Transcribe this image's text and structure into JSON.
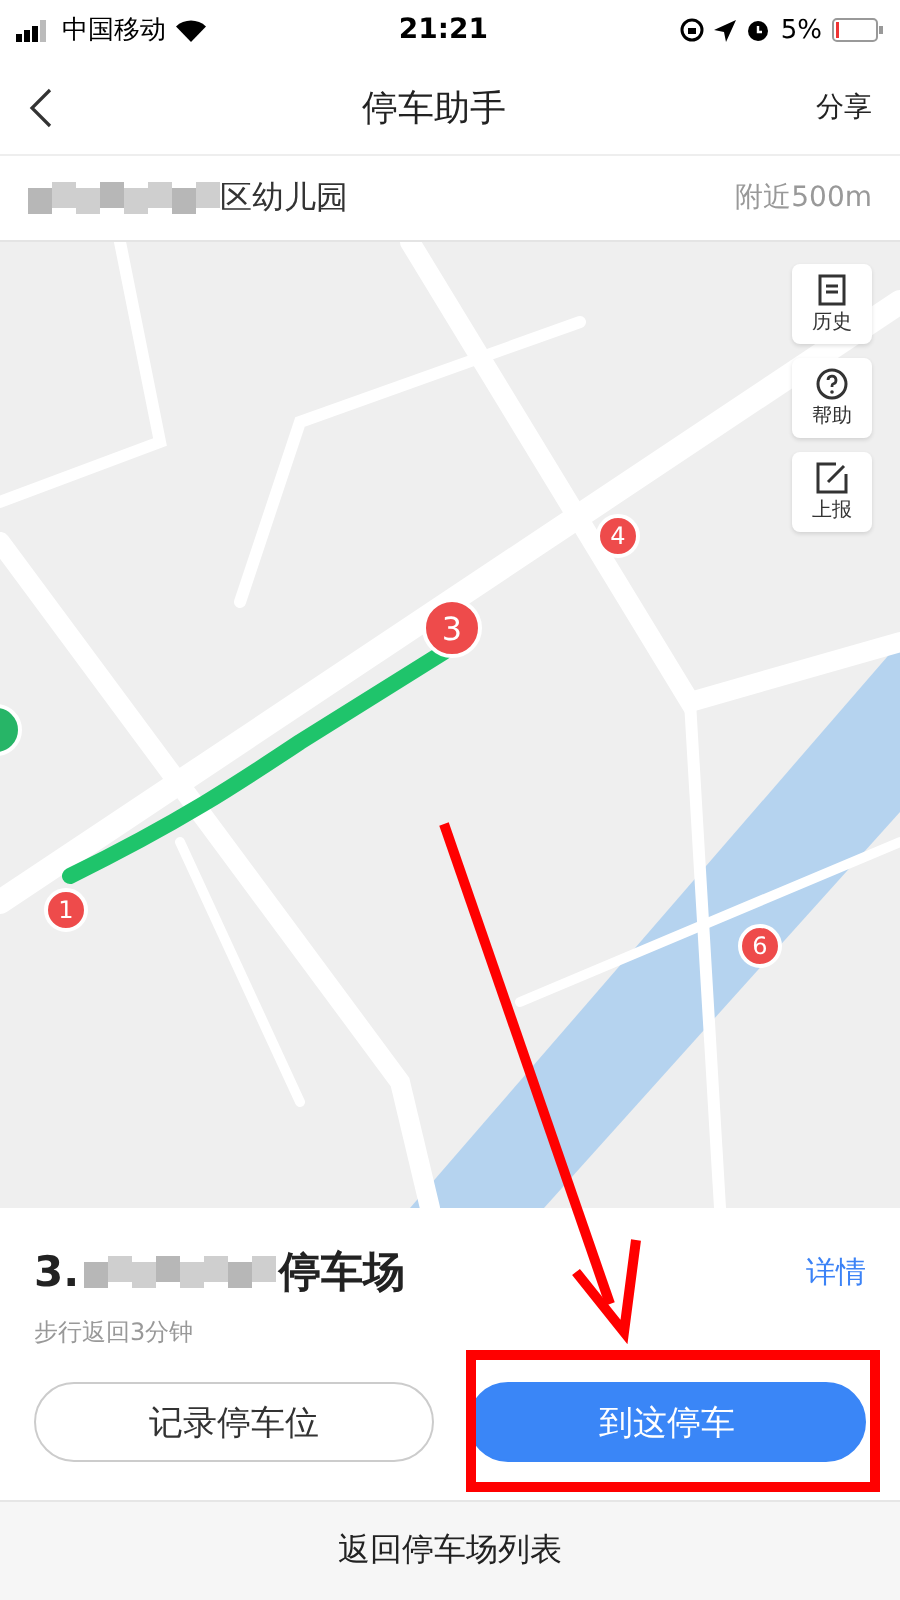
{
  "status_bar": {
    "carrier": "中国移动",
    "time": "21:21",
    "battery": "5%"
  },
  "nav": {
    "title": "停车助手",
    "action": "分享"
  },
  "location": {
    "name": "区幼儿园",
    "distance": "附近500m"
  },
  "map_tools": [
    {
      "label": "历史",
      "kind": "history"
    },
    {
      "label": "帮助",
      "kind": "help"
    },
    {
      "label": "上报",
      "kind": "report"
    }
  ],
  "markers": [
    {
      "label": "1",
      "kind": "dot"
    },
    {
      "label": "3",
      "kind": "pin"
    },
    {
      "label": "4",
      "kind": "dot"
    },
    {
      "label": "6",
      "kind": "dot"
    }
  ],
  "parking": {
    "index": "3.",
    "name": "停车场",
    "detail": "详情",
    "walk": "步行返回3分钟"
  },
  "buttons": [
    {
      "label": "记录停车位",
      "kind": "outline"
    },
    {
      "label": "到这停车",
      "kind": "primary"
    }
  ],
  "footer": "返回停车场列表"
}
